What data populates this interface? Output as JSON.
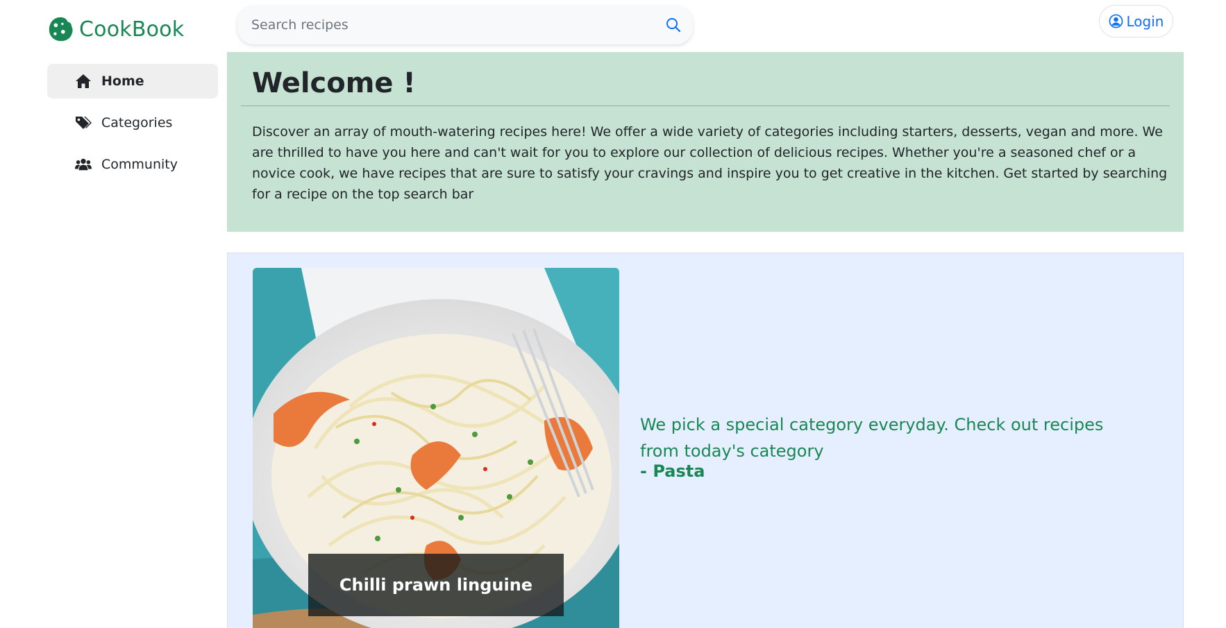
{
  "brand": {
    "name": "CookBook",
    "color": "#198754",
    "icon": "cookie-icon"
  },
  "search": {
    "placeholder": "Search recipes",
    "value": "",
    "icon": "search-icon"
  },
  "header": {
    "login_label": "Login",
    "login_icon": "user-circle-icon"
  },
  "sidebar": {
    "items": [
      {
        "label": "Home",
        "icon": "home-icon",
        "active": true
      },
      {
        "label": "Categories",
        "icon": "tags-icon",
        "active": false
      },
      {
        "label": "Community",
        "icon": "users-icon",
        "active": false
      }
    ]
  },
  "welcome": {
    "title": "Welcome !",
    "body": "Discover an array of mouth-watering recipes here! We offer a wide variety of categories including starters, desserts, vegan and more. We are thrilled to have you here and can't wait for you to explore our collection of delicious recipes. Whether you're a seasoned chef or a novice cook, we have recipes that are sure to satisfy your cravings and inspire you to get creative in the kitchen. Get started by searching for a recipe on the top search bar",
    "background": "#c5e2d3"
  },
  "featured": {
    "recipe_title": "Chilli prawn linguine",
    "message": "We pick a special category everyday. Check out recipes from today's category",
    "category": "- Pasta",
    "background": "#e6efff",
    "text_color": "#198754"
  }
}
